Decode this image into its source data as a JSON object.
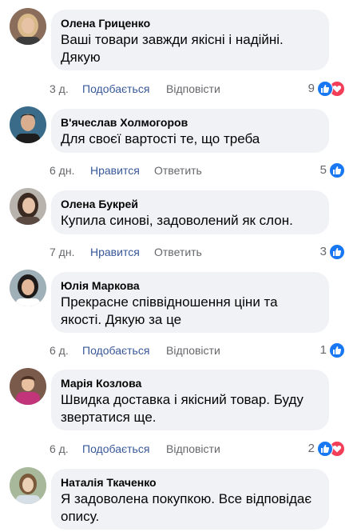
{
  "comments": [
    {
      "author": "Олена Гриценко",
      "text": "Ваші товари завжди якісні і надійні. Дякую",
      "time": "3 д.",
      "like_label": "Подобається",
      "reply_label": "Відповісти",
      "reaction_count": "9",
      "reactions": [
        "like-icon",
        "love-icon"
      ],
      "avatar_colors": {
        "bg": "#8a6d5a",
        "hair": "#d9b98a",
        "face": "#e8c2a4"
      }
    },
    {
      "author": "В'ячеслав Холмогоров",
      "text": "Для своєї вартості те, що треба",
      "time": "6 дн.",
      "like_label": "Нравится",
      "reply_label": "Ответить",
      "reaction_count": "5",
      "reactions": [
        "like-icon"
      ],
      "avatar_colors": {
        "bg": "#3a6c8a",
        "hair": "#2b2b2b",
        "face": "#d9ae8e"
      }
    },
    {
      "author": "Олена Букрей",
      "text": "Купила синові, задоволений як слон.",
      "time": "7 дн.",
      "like_label": "Нравится",
      "reply_label": "Ответить",
      "reaction_count": "3",
      "reactions": [
        "like-icon"
      ],
      "avatar_colors": {
        "bg": "#b9b3ad",
        "hair": "#3b2a22",
        "face": "#e6c3a8"
      }
    },
    {
      "author": "Юлія Маркова",
      "text": "Прекрасне співвідношення ціни та якості. Дякую за це",
      "time": "6 д.",
      "like_label": "Подобається",
      "reply_label": "Відповісти",
      "reaction_count": "1",
      "reactions": [
        "like-icon"
      ],
      "avatar_colors": {
        "bg": "#9fb0b8",
        "hair": "#1e1a1a",
        "face": "#e3b89a"
      }
    },
    {
      "author": "Марія Козлова",
      "text": "Швидка доставка і якісний товар. Буду звертатися ще.",
      "time": "6 д.",
      "like_label": "Подобається",
      "reply_label": "Відповісти",
      "reaction_count": "2",
      "reactions": [
        "like-icon",
        "love-icon"
      ],
      "avatar_colors": {
        "bg": "#7a5a4a",
        "hair": "#c2357a",
        "face": "#e9c0a0"
      }
    },
    {
      "author": "Наталія Ткаченко",
      "text": "Я задоволена покупкою. Все відповідає опису.",
      "time": "",
      "like_label": "",
      "reply_label": "",
      "reaction_count": "",
      "reactions": [],
      "avatar_colors": {
        "bg": "#a8b89a",
        "hair": "#7a5a3a",
        "face": "#ecd0b6"
      }
    }
  ],
  "colors": {
    "bubble": "#f0f2f5",
    "link": "#385898",
    "muted": "#65676b",
    "like_blue": "#1877f2",
    "love_red": "#f33e58"
  }
}
